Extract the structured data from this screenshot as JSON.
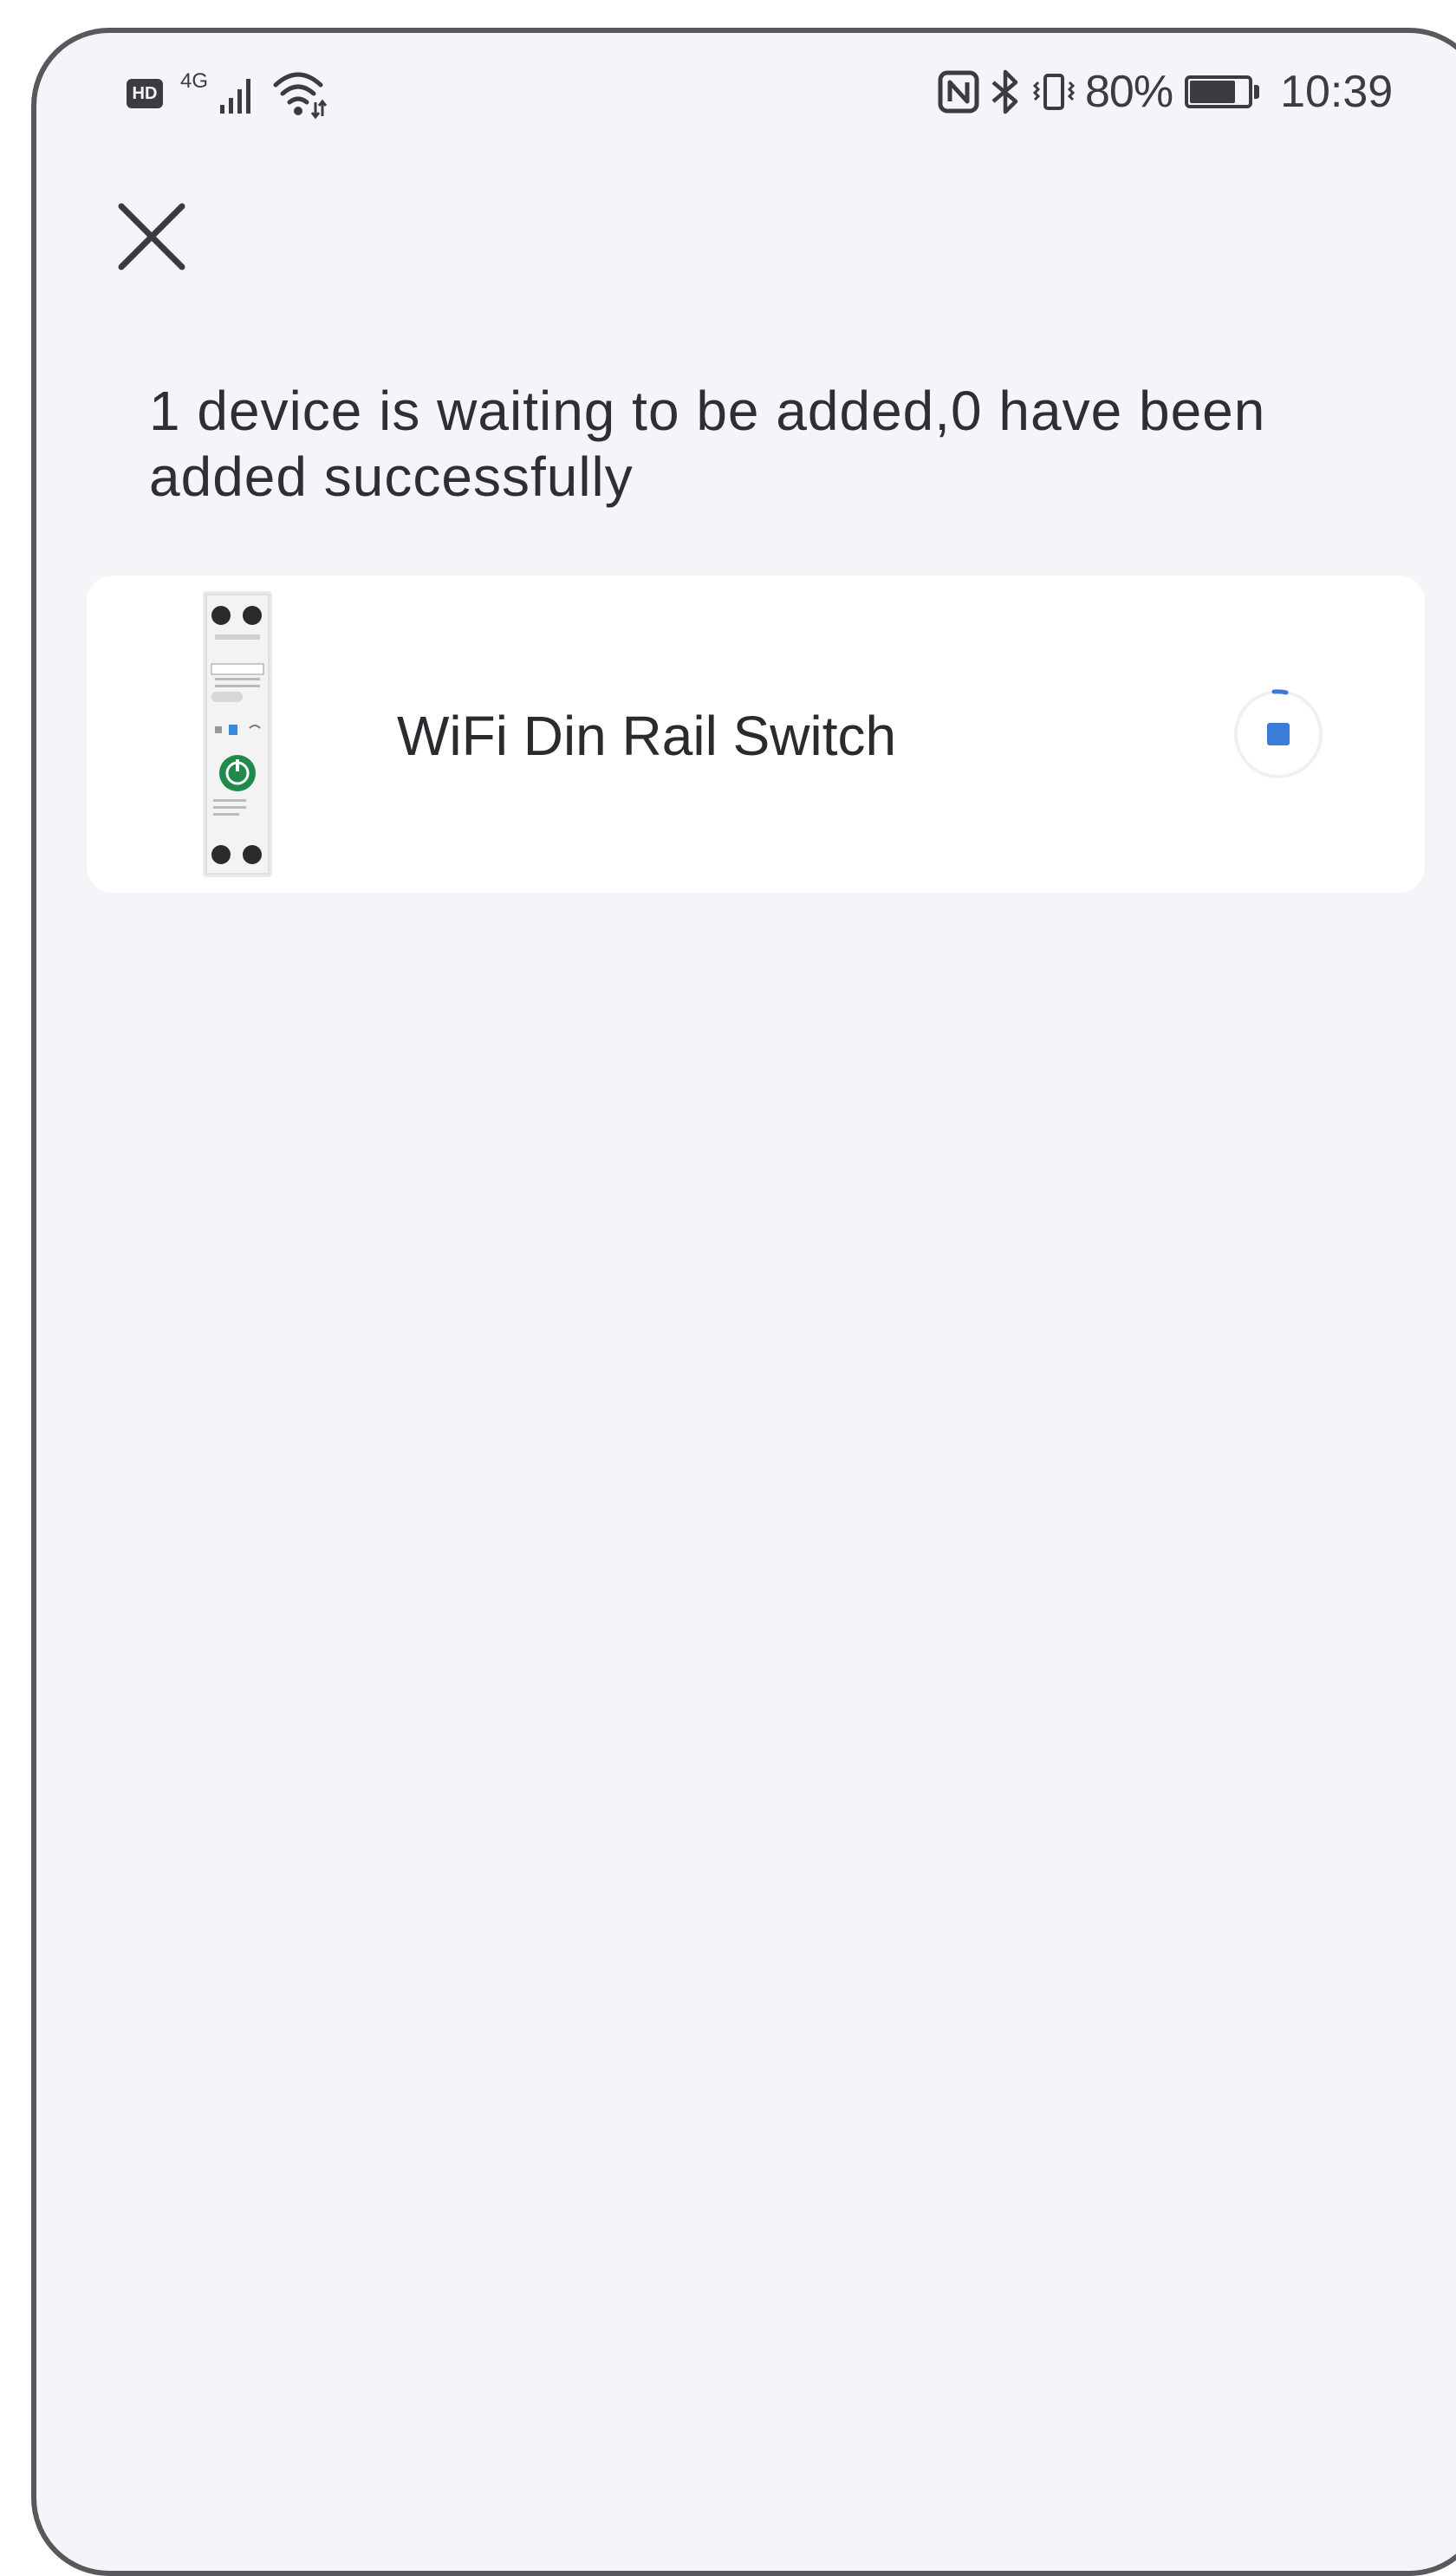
{
  "status_bar": {
    "hd_badge": "HD",
    "network_type": "4G",
    "battery_percent": "80%",
    "battery_level": 0.8,
    "time": "10:39"
  },
  "header": {
    "close_icon": "close-icon"
  },
  "main": {
    "heading": "1 device is waiting to be added,0 have been added successfully",
    "devices": [
      {
        "name": "WiFi Din Rail Switch",
        "status_icon": "loading-spinner-icon"
      }
    ]
  },
  "colors": {
    "background": "#f5f5f9",
    "card": "#ffffff",
    "text": "#2e2e33",
    "accent": "#3b7cd6"
  }
}
